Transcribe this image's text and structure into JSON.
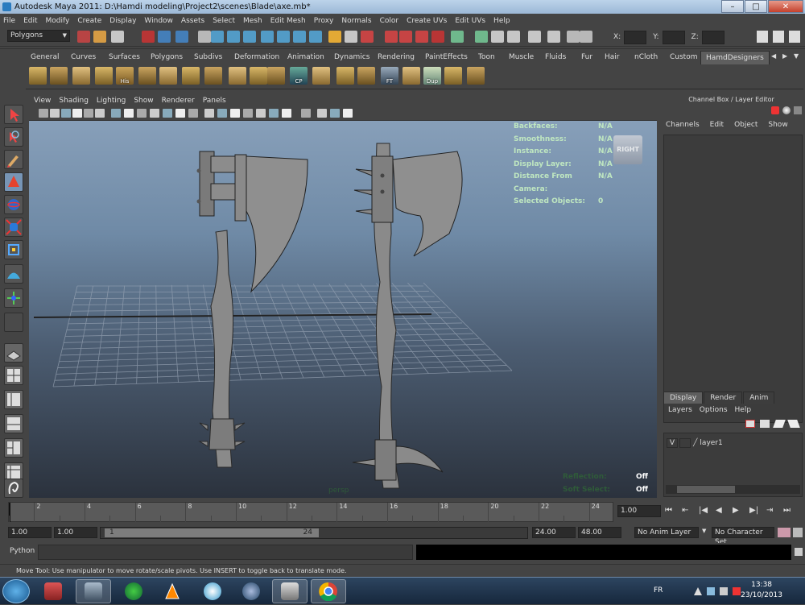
{
  "window": {
    "title": "Autodesk Maya 2011: D:\\Hamdi modeling\\Project2\\scenes\\Blade\\axe.mb*",
    "minimize": "–",
    "maximize": "□",
    "close": "✕"
  },
  "menubar": [
    "File",
    "Edit",
    "Modify",
    "Create",
    "Display",
    "Window",
    "Assets",
    "Select",
    "Mesh",
    "Edit Mesh",
    "Proxy",
    "Normals",
    "Color",
    "Create UVs",
    "Edit UVs",
    "Help"
  ],
  "statusline": {
    "mode": "Polygons",
    "x_label": "X:",
    "y_label": "Y:",
    "z_label": "Z:"
  },
  "shelf_tabs": [
    "General",
    "Curves",
    "Surfaces",
    "Polygons",
    "Subdivs",
    "Deformation",
    "Animation",
    "Dynamics",
    "Rendering",
    "PaintEffects",
    "Toon",
    "Muscle",
    "Fluids",
    "Fur",
    "Hair",
    "nCloth",
    "Custom",
    "HamdDesigners"
  ],
  "shelf_active_tab": "HamdDesigners",
  "shelf_labels": {
    "his": "His",
    "cp": "CP",
    "ft": "FT",
    "dup": "Dup"
  },
  "viewport_menu": [
    "View",
    "Shading",
    "Lighting",
    "Show",
    "Renderer",
    "Panels"
  ],
  "hud": [
    {
      "label": "Backfaces:",
      "value": "N/A"
    },
    {
      "label": "Smoothness:",
      "value": "N/A"
    },
    {
      "label": "Instance:",
      "value": "N/A"
    },
    {
      "label": "Display Layer:",
      "value": "N/A"
    },
    {
      "label": "Distance From Camera:",
      "value": "N/A"
    },
    {
      "label": "Selected Objects:",
      "value": "0"
    }
  ],
  "viewcube_label": "RIGHT",
  "camera_label": "persp",
  "hud_bottom": [
    {
      "label": "Reflection:",
      "value": "Off"
    },
    {
      "label": "Soft Select:",
      "value": "Off"
    }
  ],
  "channel_box": {
    "title": "Channel Box / Layer Editor",
    "menu": [
      "Channels",
      "Edit",
      "Object",
      "Show"
    ]
  },
  "layer_editor": {
    "tabs": [
      "Display",
      "Render",
      "Anim"
    ],
    "menu": [
      "Layers",
      "Options",
      "Help"
    ],
    "layers": [
      {
        "visible": "V",
        "name": "layer1"
      }
    ]
  },
  "timeline": {
    "ticks": [
      "2",
      "4",
      "6",
      "8",
      "10",
      "12",
      "14",
      "16",
      "18",
      "20",
      "22",
      "24"
    ],
    "current_frame": "1.00"
  },
  "range": {
    "start": "1.00",
    "anim_start": "1.00",
    "range_start": "1",
    "range_end": "24",
    "end": "24.00",
    "anim_end": "48.00",
    "anim_layer": "No Anim Layer",
    "char_set": "No Character Set"
  },
  "command_line": {
    "label": "Python"
  },
  "help_line": "Move Tool: Use manipulator to move rotate/scale pivots. Use INSERT to toggle back to translate mode.",
  "taskbar": {
    "lang": "FR",
    "time": "13:38",
    "date": "23/10/2013"
  }
}
